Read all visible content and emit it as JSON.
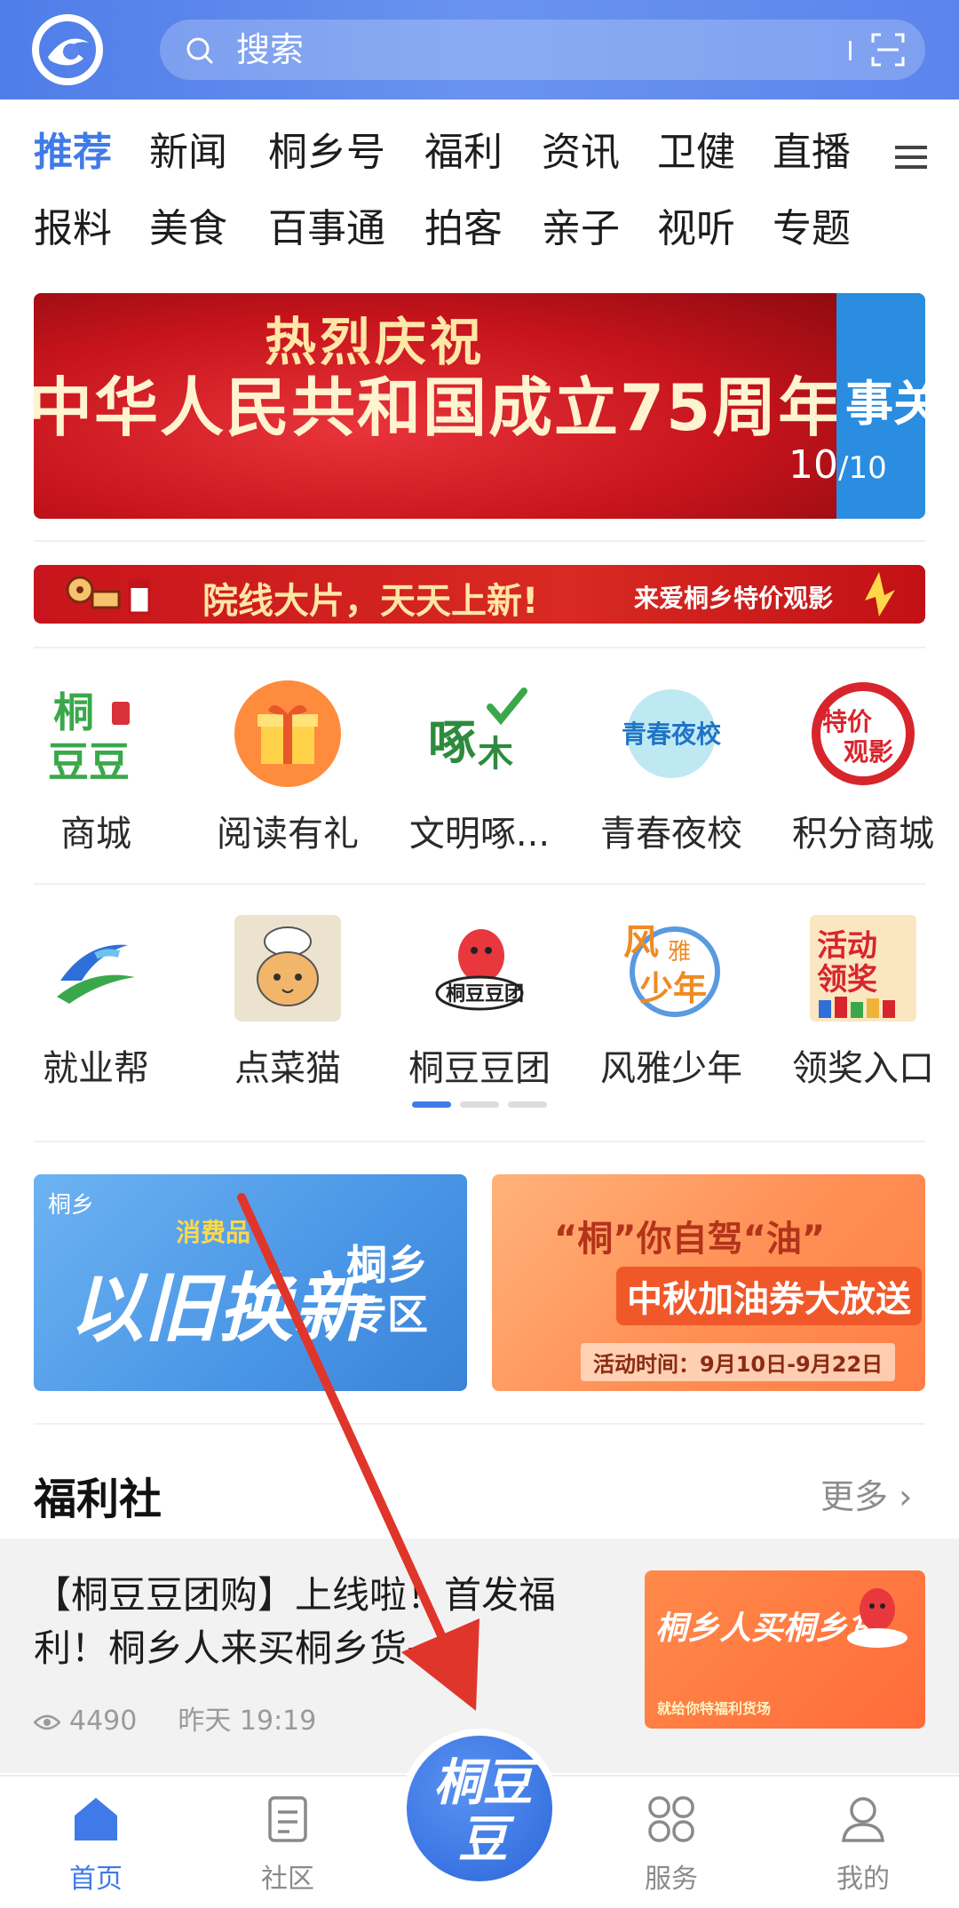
{
  "header": {
    "search_placeholder": "搜索"
  },
  "tabs": {
    "row1": [
      "推荐",
      "新闻",
      "桐乡号",
      "福利",
      "资讯",
      "卫健",
      "直播"
    ],
    "row2": [
      "报料",
      "美食",
      "百事通",
      "拍客",
      "亲子",
      "视听",
      "专题"
    ],
    "active_index": 0
  },
  "banner": {
    "title": "热烈庆祝",
    "subtitle": "中华人民共和国成立75周年",
    "side_text": "事关",
    "counter_current": "10",
    "counter_total": "/10"
  },
  "cinema": {
    "left_text": "院线大片，天天上新!",
    "right_text": "来爱桐乡特价观影"
  },
  "services": {
    "page1_row1": [
      {
        "label": "商城",
        "icon": "tongdoudou-mall-icon"
      },
      {
        "label": "阅读有礼",
        "icon": "gift-box-icon"
      },
      {
        "label": "文明啄...",
        "icon": "zhuomu-icon"
      },
      {
        "label": "青春夜校",
        "icon": "youth-night-school-icon"
      },
      {
        "label": "积分商城",
        "icon": "discount-movie-icon"
      }
    ],
    "page1_row2": [
      {
        "label": "就业帮",
        "icon": "employment-icon"
      },
      {
        "label": "点菜猫",
        "icon": "chef-cat-icon"
      },
      {
        "label": "桐豆豆团",
        "icon": "bean-mascot-icon"
      },
      {
        "label": "风雅少年",
        "icon": "fengya-youth-icon"
      },
      {
        "label": "领奖入口",
        "icon": "prize-entry-icon"
      }
    ],
    "page_indicator": {
      "pages": 3,
      "current": 1
    }
  },
  "promos": {
    "left": {
      "logo": "桐乡",
      "small": "消费品",
      "big": "以旧换新",
      "zone": "桐乡专区"
    },
    "right": {
      "line1": "“桐”你自驾“油”",
      "line2": "中秋加油券大放送",
      "line3": "活动时间：9月10日-9月22日"
    }
  },
  "welfare": {
    "title": "福利社",
    "more": "更多 ›"
  },
  "article": {
    "title": "【桐豆豆团购】上线啦！首发福利！桐乡人来买桐乡货→",
    "views": "4490",
    "time": "昨天  19:19",
    "thumb_text": "桐乡人买桐乡货",
    "thumb_sub": "就给你特福利货场"
  },
  "bottom_nav": {
    "items": [
      {
        "label": "首页",
        "icon": "home-icon"
      },
      {
        "label": "社区",
        "icon": "community-icon"
      },
      {
        "label": "服务",
        "icon": "services-icon"
      },
      {
        "label": "我的",
        "icon": "profile-icon"
      }
    ],
    "center_label": "桐豆豆",
    "active_index": 0
  },
  "colors": {
    "brand": "#3f7ae8",
    "header": "#5b85ec",
    "annotation_arrow": "#e0352b"
  }
}
